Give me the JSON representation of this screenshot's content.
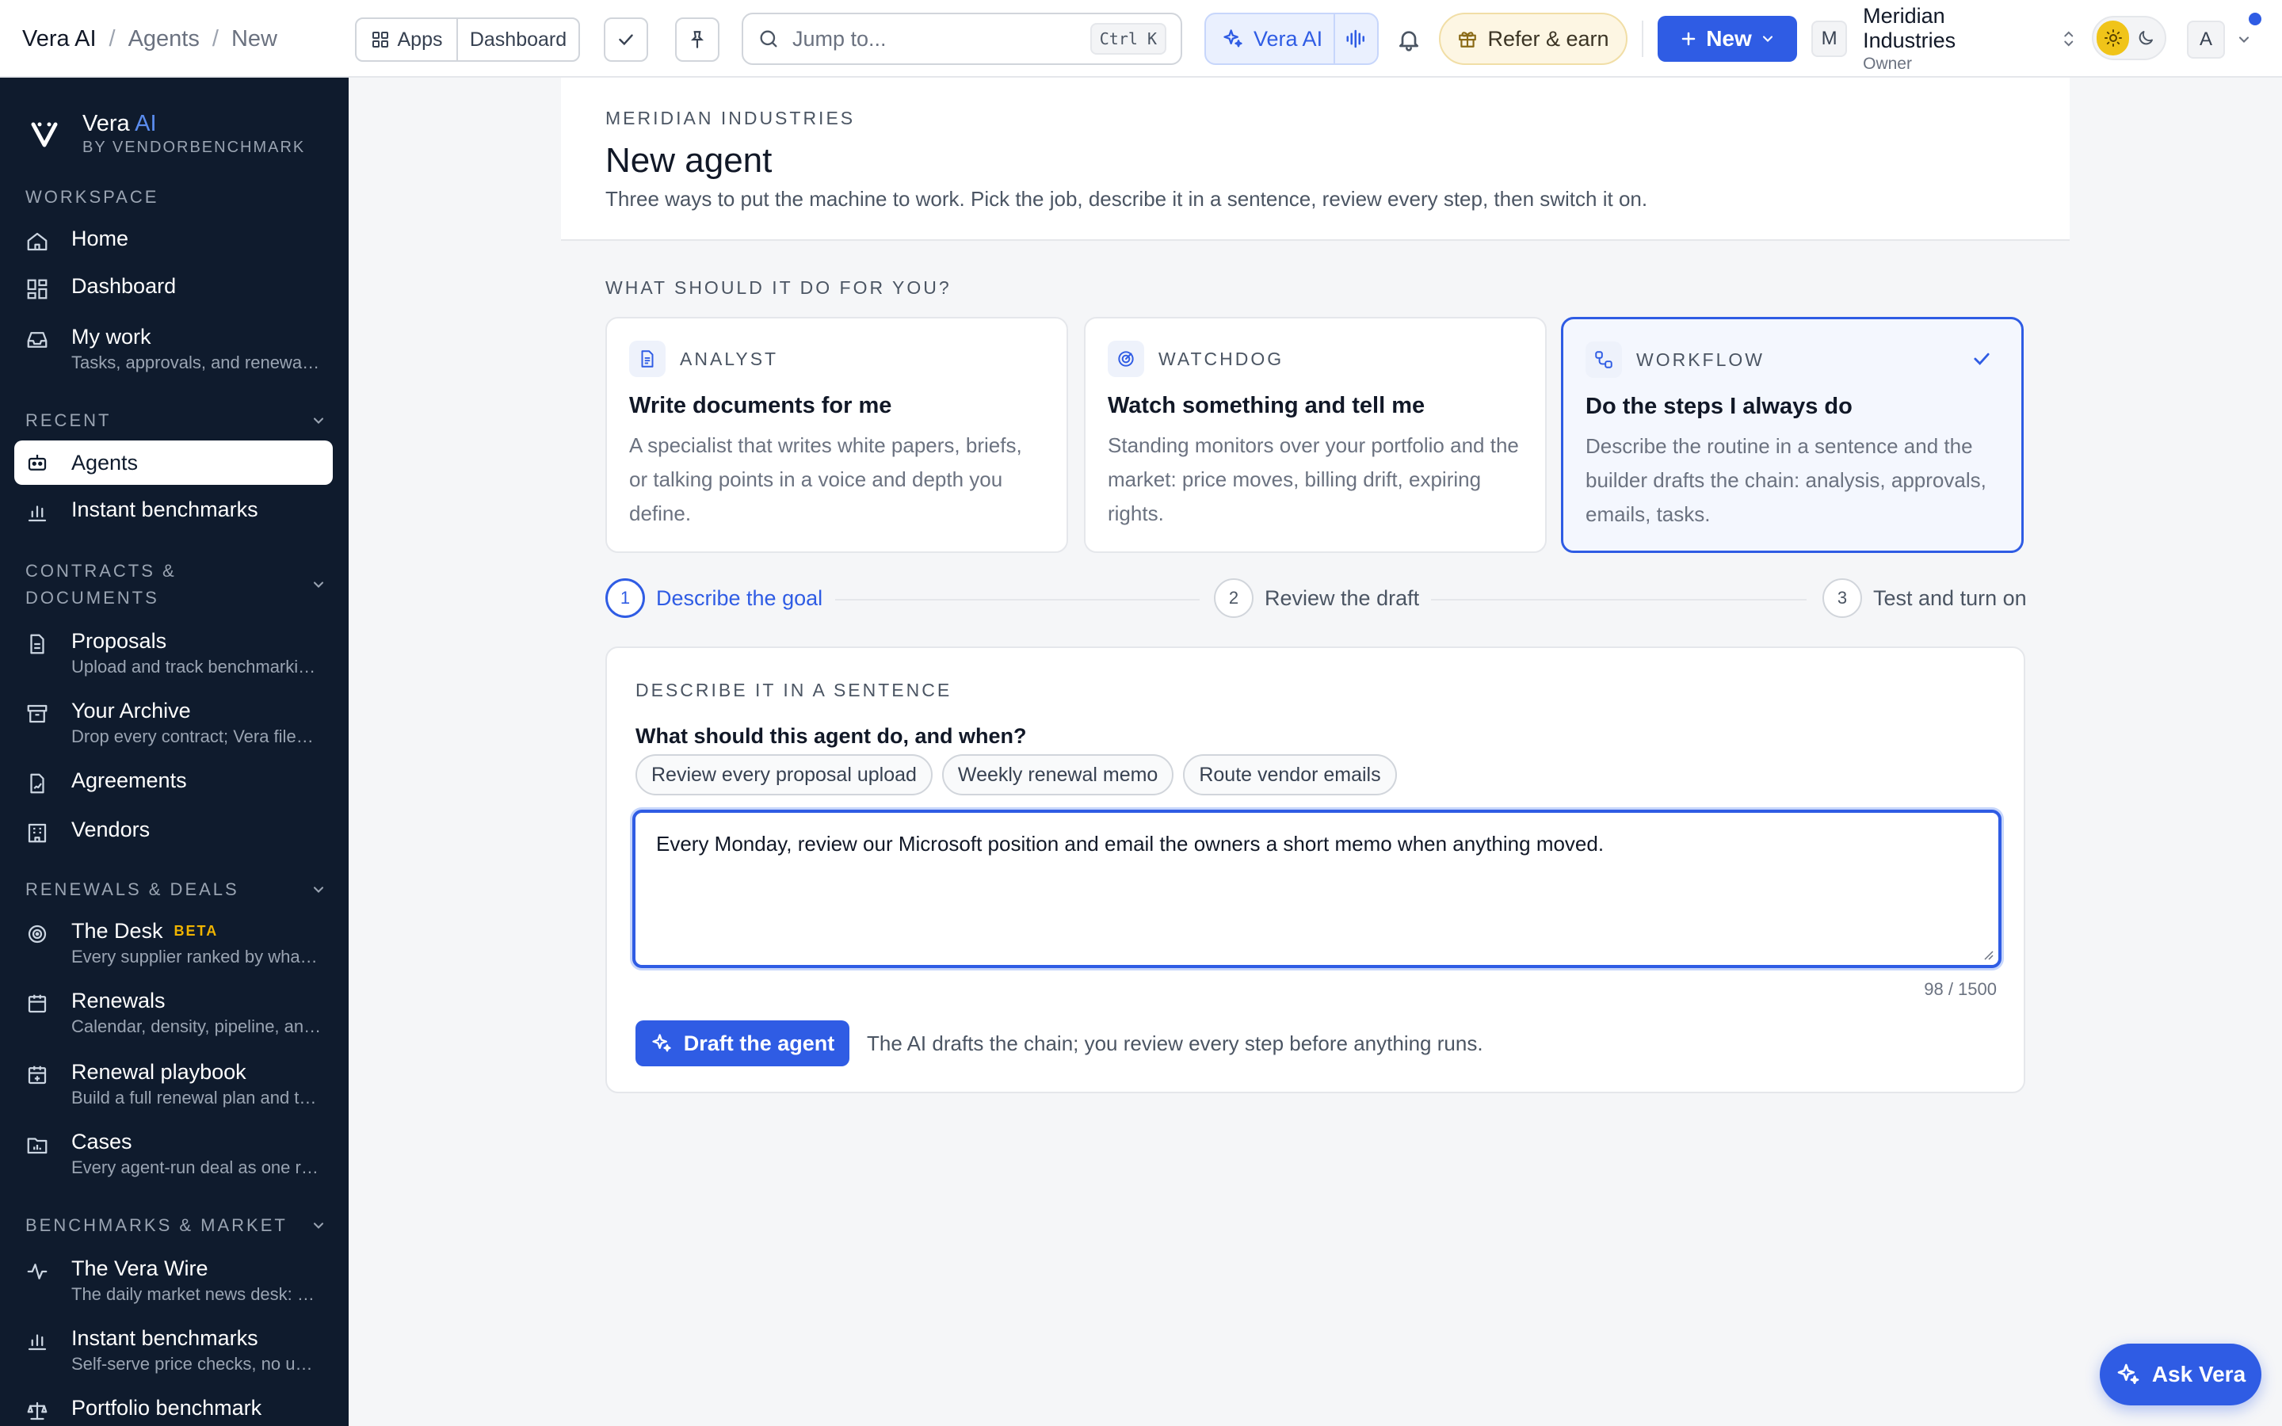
{
  "breadcrumb": {
    "items": [
      "Vera AI",
      "Agents",
      "New"
    ]
  },
  "topbar": {
    "apps_label": "Apps",
    "dashboard_label": "Dashboard",
    "search_placeholder": "Jump to...",
    "search_shortcut": "Ctrl K",
    "vera_label": "Vera AI",
    "refer_label": "Refer & earn",
    "new_label": "New",
    "org_initial": "M",
    "org_name": "Meridian Industries",
    "org_role": "Owner",
    "user_initial": "A"
  },
  "sidebar": {
    "brand_name": "Vera",
    "brand_ai": "AI",
    "brand_by": "BY VENDORBENCHMARK",
    "sections": {
      "workspace": "WORKSPACE",
      "recent": "RECENT",
      "contracts": "CONTRACTS &",
      "contracts2": "DOCUMENTS",
      "renewals": "RENEWALS & DEALS",
      "benchmarks": "BENCHMARKS & MARKET"
    },
    "items": {
      "home": {
        "label": "Home"
      },
      "dashboard": {
        "label": "Dashboard"
      },
      "mywork": {
        "label": "My work",
        "sub": "Tasks, approvals, and renewals ..."
      },
      "agents": {
        "label": "Agents"
      },
      "instant1": {
        "label": "Instant benchmarks"
      },
      "proposals": {
        "label": "Proposals",
        "sub": "Upload and track benchmarkin..."
      },
      "archive": {
        "label": "Your Archive",
        "sub": "Drop every contract; Vera files t..."
      },
      "agreements": {
        "label": "Agreements"
      },
      "vendors": {
        "label": "Vendors"
      },
      "desk": {
        "label": "The Desk",
        "badge": "BETA",
        "sub": "Every supplier ranked by what i..."
      },
      "renewals": {
        "label": "Renewals",
        "sub": "Calendar, density, pipeline, and..."
      },
      "playbook": {
        "label": "Renewal playbook",
        "sub": "Build a full renewal plan and tu..."
      },
      "cases": {
        "label": "Cases",
        "sub": "Every agent-run deal as one rec..."
      },
      "wire": {
        "label": "The Vera Wire",
        "sub": "The daily market news desk: pri..."
      },
      "instant2": {
        "label": "Instant benchmarks",
        "sub": "Self-serve price checks, no uplo..."
      },
      "portfolio": {
        "label": "Portfolio benchmark"
      }
    }
  },
  "header": {
    "eyebrow": "MERIDIAN INDUSTRIES",
    "title": "New agent",
    "description": "Three ways to put the machine to work. Pick the job, describe it in a sentence, review every step, then switch it on."
  },
  "choose": {
    "heading": "WHAT SHOULD IT DO FOR YOU?",
    "cards": [
      {
        "kind": "ANALYST",
        "title": "Write documents for me",
        "body": "A specialist that writes white papers, briefs, or talking points in a voice and depth you define."
      },
      {
        "kind": "WATCHDOG",
        "title": "Watch something and tell me",
        "body": "Standing monitors over your portfolio and the market: price moves, billing drift, expiring rights."
      },
      {
        "kind": "WORKFLOW",
        "title": "Do the steps I always do",
        "body": "Describe the routine in a sentence and the builder drafts the chain: analysis, approvals, emails, tasks."
      }
    ]
  },
  "steps": [
    {
      "num": "1",
      "label": "Describe the goal"
    },
    {
      "num": "2",
      "label": "Review the draft"
    },
    {
      "num": "3",
      "label": "Test and turn on"
    }
  ],
  "describe": {
    "eyebrow": "DESCRIBE IT IN A SENTENCE",
    "question": "What should this agent do, and when?",
    "chips": [
      "Review every proposal upload",
      "Weekly renewal memo",
      "Route vendor emails"
    ],
    "value": "Every Monday, review our Microsoft position and email the owners a short memo when anything moved.",
    "count": "98 / 1500",
    "draft_label": "Draft the agent",
    "draft_note": "The AI drafts the chain; you review every step before anything runs."
  },
  "ask_label": "Ask Vera",
  "colors": {
    "accent": "#2f5ce4",
    "sidebar": "#0f1b2d",
    "beta": "#f0b400",
    "sun": "#f0c419"
  }
}
